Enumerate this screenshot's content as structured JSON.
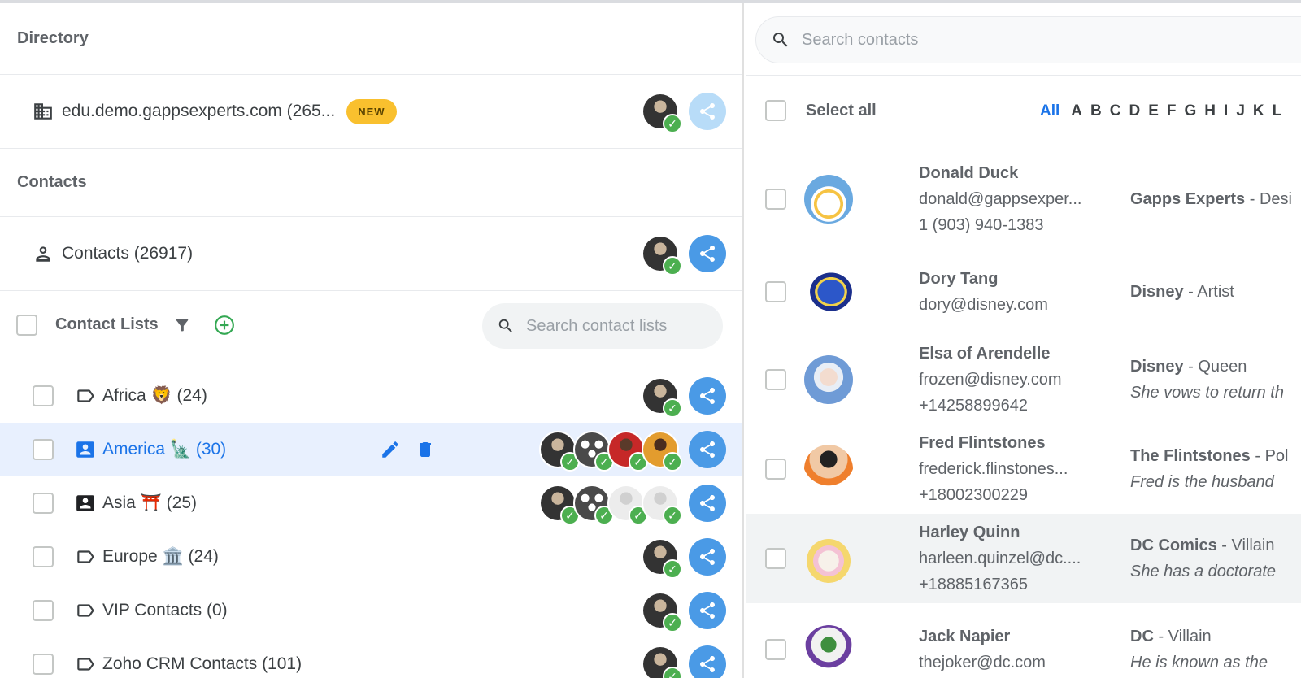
{
  "directory": {
    "title": "Directory",
    "domain_label": "edu.demo.gappsexperts.com (265...",
    "new_badge": "NEW"
  },
  "contacts": {
    "title": "Contacts",
    "item_label": "Contacts (26917)"
  },
  "contact_lists": {
    "title": "Contact Lists",
    "search_placeholder": "Search contact lists",
    "items": [
      {
        "label": "Africa 🦁 (24)"
      },
      {
        "label": "America 🗽 (30)"
      },
      {
        "label": "Asia ⛩️ (25)"
      },
      {
        "label": "Europe 🏛️ (24)"
      },
      {
        "label": "VIP Contacts (0)"
      },
      {
        "label": "Zoho CRM Contacts (101)"
      }
    ]
  },
  "search": {
    "placeholder": "Search contacts"
  },
  "select_all": {
    "label": "Select all",
    "letters": [
      "All",
      "A",
      "B",
      "C",
      "D",
      "E",
      "F",
      "G",
      "H",
      "I",
      "J",
      "K",
      "L"
    ]
  },
  "people": [
    {
      "name": "Donald Duck",
      "email": "donald@gappsexper...",
      "phone": "1 (903) 940-1383",
      "org": "Gapps Experts",
      "role": " - Desi",
      "note": ""
    },
    {
      "name": "Dory Tang",
      "email": "dory@disney.com",
      "phone": "",
      "org": "Disney",
      "role": " - Artist",
      "note": ""
    },
    {
      "name": "Elsa of Arendelle",
      "email": "frozen@disney.com",
      "phone": "+14258899642",
      "org": "Disney",
      "role": " - Queen",
      "note": "She vows to return th"
    },
    {
      "name": "Fred Flintstones",
      "email": "frederick.flinstones...",
      "phone": "+18002300229",
      "org": "The Flintstones",
      "role": " - Pol",
      "note": "Fred is the husband"
    },
    {
      "name": "Harley Quinn",
      "email": "harleen.quinzel@dc....",
      "phone": "+18885167365",
      "org": "DC Comics",
      "role": " - Villain",
      "note": "She has a doctorate"
    },
    {
      "name": "Jack Napier",
      "email": "thejoker@dc.com",
      "phone": "",
      "org": "DC",
      "role": " - Villain",
      "note": "He is known as the"
    }
  ],
  "colors": {
    "accent": "#1a73e8",
    "share": "#4a9ae6",
    "check": "#4caf50",
    "badge": "#f9c02e",
    "selected_row": "#e8f0fe"
  }
}
